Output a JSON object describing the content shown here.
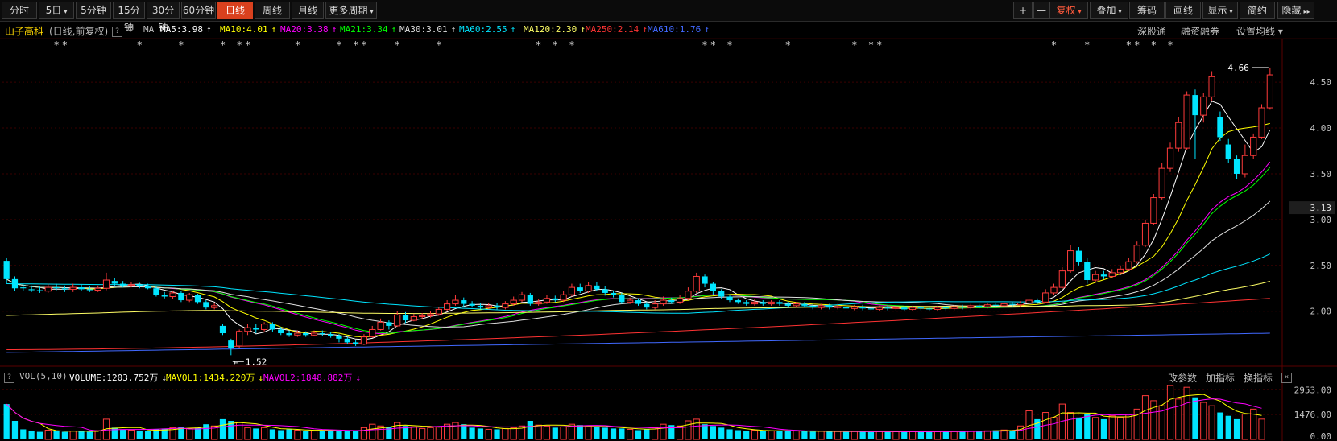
{
  "toolbar": {
    "periods": [
      {
        "label": "分时",
        "active": false
      },
      {
        "label": "5日",
        "active": false,
        "dropdown": true
      },
      {
        "label": "5分钟",
        "active": false
      },
      {
        "label": "15分钟",
        "active": false
      },
      {
        "label": "30分钟",
        "active": false
      },
      {
        "label": "60分钟",
        "active": false
      },
      {
        "label": "日线",
        "active": true
      },
      {
        "label": "周线",
        "active": false
      },
      {
        "label": "月线",
        "active": false
      },
      {
        "label": "更多周期",
        "active": false,
        "dropdown": true
      }
    ],
    "right_buttons": [
      {
        "label": "+",
        "name": "zoom-in-button"
      },
      {
        "label": "—",
        "name": "zoom-out-button"
      },
      {
        "label": "复权",
        "name": "fuquan-button",
        "dropdown": true
      },
      {
        "label": "叠加",
        "name": "overlay-button",
        "dropdown": true
      },
      {
        "label": "筹码",
        "name": "chips-button"
      },
      {
        "label": "画线",
        "name": "draw-line-button"
      },
      {
        "label": "显示",
        "name": "display-button",
        "dropdown": true
      },
      {
        "label": "简约",
        "name": "simple-button"
      },
      {
        "label": "隐藏",
        "name": "hide-button"
      }
    ]
  },
  "info": {
    "stock_name": "山子高科",
    "sub": "(日线,前复权)",
    "ma_label": "MA",
    "ma_items": [
      {
        "text": "MA5:3.98",
        "arrow": "↑",
        "color": "#ffffff"
      },
      {
        "text": "MA10:4.01",
        "arrow": "↑",
        "color": "#ffff00"
      },
      {
        "text": "MA20:3.38",
        "arrow": "↑",
        "color": "#ff00ff"
      },
      {
        "text": "MA21:3.34",
        "arrow": "↑",
        "color": "#00ff00"
      },
      {
        "text": "MA30:3.01",
        "arrow": "↑",
        "color": "#e0e0e0"
      },
      {
        "text": "MA60:2.55",
        "arrow": "↑",
        "color": "#00e5ff"
      },
      {
        "text": "MA120:2.30",
        "arrow": "↑",
        "color": "#ffff66"
      },
      {
        "text": "MA250:2.14",
        "arrow": "↑",
        "color": "#ff3333"
      },
      {
        "text": "MA610:1.76",
        "arrow": "↑",
        "color": "#4169ff"
      }
    ],
    "right_links": [
      "深股通",
      "融资融券",
      "设置均线"
    ]
  },
  "vol_info": {
    "label": "VOL(5,10)",
    "items": [
      {
        "text": "VOLUME:1203.752万",
        "arrow": "↓",
        "color": "#ffffff"
      },
      {
        "text": "MAVOL1:1434.220万",
        "arrow": "↓",
        "color": "#ffff00"
      },
      {
        "text": "MAVOL2:1848.882万",
        "arrow": "↓",
        "color": "#ff00ff"
      }
    ],
    "right_links": [
      "改参数",
      "加指标",
      "换指标"
    ]
  },
  "colors": {
    "up": "#ff3b3b",
    "down": "#00e5ff",
    "bg": "#000000",
    "grid": "#3a0000",
    "axis": "#c8c8c8"
  },
  "chart_data": {
    "type": "candlestick",
    "price_axis_ticks": [
      "4.50",
      "4.00",
      "3.50",
      "3.00",
      "2.50",
      "2.00"
    ],
    "current_price_label": "3.13",
    "ylim": [
      1.4,
      4.8
    ],
    "high_annotation": "4.66",
    "low_annotation": "1.52",
    "candles": [
      [
        2.55,
        2.35,
        2.58,
        2.3
      ],
      [
        2.35,
        2.25,
        2.38,
        2.22
      ],
      [
        2.26,
        2.25,
        2.3,
        2.22
      ],
      [
        2.24,
        2.23,
        2.28,
        2.21
      ],
      [
        2.23,
        2.22,
        2.27,
        2.2
      ],
      [
        2.22,
        2.26,
        2.3,
        2.2
      ],
      [
        2.26,
        2.25,
        2.3,
        2.23
      ],
      [
        2.25,
        2.24,
        2.28,
        2.21
      ],
      [
        2.24,
        2.26,
        2.3,
        2.21
      ],
      [
        2.26,
        2.24,
        2.29,
        2.22
      ],
      [
        2.24,
        2.23,
        2.27,
        2.21
      ],
      [
        2.23,
        2.25,
        2.28,
        2.21
      ],
      [
        2.25,
        2.34,
        2.42,
        2.23
      ],
      [
        2.33,
        2.3,
        2.36,
        2.27
      ],
      [
        2.3,
        2.28,
        2.33,
        2.26
      ],
      [
        2.28,
        2.29,
        2.32,
        2.26
      ],
      [
        2.29,
        2.27,
        2.31,
        2.25
      ],
      [
        2.27,
        2.25,
        2.3,
        2.24
      ],
      [
        2.25,
        2.18,
        2.27,
        2.16
      ],
      [
        2.18,
        2.16,
        2.21,
        2.14
      ],
      [
        2.16,
        2.2,
        2.22,
        2.13
      ],
      [
        2.2,
        2.12,
        2.22,
        2.1
      ],
      [
        2.12,
        2.18,
        2.2,
        2.1
      ],
      [
        2.18,
        2.1,
        2.19,
        2.08
      ],
      [
        2.1,
        2.04,
        2.12,
        2.02
      ],
      [
        2.04,
        2.06,
        2.09,
        2.02
      ],
      [
        1.84,
        1.76,
        1.86,
        1.74
      ],
      [
        1.68,
        1.6,
        1.7,
        1.52
      ],
      [
        1.62,
        1.78,
        1.8,
        1.6
      ],
      [
        1.78,
        1.82,
        1.86,
        1.74
      ],
      [
        1.82,
        1.8,
        1.86,
        1.76
      ],
      [
        1.8,
        1.86,
        1.88,
        1.78
      ],
      [
        1.86,
        1.8,
        1.88,
        1.77
      ],
      [
        1.8,
        1.76,
        1.83,
        1.74
      ],
      [
        1.76,
        1.74,
        1.79,
        1.72
      ],
      [
        1.74,
        1.76,
        1.79,
        1.72
      ],
      [
        1.76,
        1.74,
        1.78,
        1.72
      ],
      [
        1.74,
        1.76,
        1.79,
        1.73
      ],
      [
        1.76,
        1.75,
        1.79,
        1.73
      ],
      [
        1.75,
        1.73,
        1.77,
        1.71
      ],
      [
        1.73,
        1.7,
        1.75,
        1.66
      ],
      [
        1.7,
        1.66,
        1.72,
        1.64
      ],
      [
        1.66,
        1.64,
        1.69,
        1.62
      ],
      [
        1.64,
        1.72,
        1.75,
        1.63
      ],
      [
        1.72,
        1.8,
        1.84,
        1.71
      ],
      [
        1.8,
        1.88,
        1.92,
        1.79
      ],
      [
        1.88,
        1.84,
        1.9,
        1.8
      ],
      [
        1.84,
        1.96,
        2.0,
        1.83
      ],
      [
        1.96,
        1.9,
        1.99,
        1.87
      ],
      [
        1.9,
        1.94,
        1.97,
        1.89
      ],
      [
        1.94,
        1.95,
        1.98,
        1.92
      ],
      [
        1.95,
        1.97,
        2.0,
        1.93
      ],
      [
        1.97,
        2.02,
        2.05,
        1.95
      ],
      [
        2.02,
        2.08,
        2.12,
        2.0
      ],
      [
        2.08,
        2.12,
        2.18,
        2.06
      ],
      [
        2.12,
        2.08,
        2.15,
        2.05
      ],
      [
        2.08,
        2.06,
        2.11,
        2.04
      ],
      [
        2.06,
        2.04,
        2.09,
        2.02
      ],
      [
        2.04,
        2.06,
        2.09,
        2.02
      ],
      [
        2.06,
        2.04,
        2.09,
        2.02
      ],
      [
        2.04,
        2.08,
        2.11,
        2.02
      ],
      [
        2.08,
        2.12,
        2.16,
        2.06
      ],
      [
        2.12,
        2.18,
        2.21,
        2.1
      ],
      [
        2.18,
        2.08,
        2.2,
        2.06
      ],
      [
        2.08,
        2.1,
        2.13,
        2.06
      ],
      [
        2.1,
        2.14,
        2.18,
        2.08
      ],
      [
        2.14,
        2.12,
        2.17,
        2.1
      ],
      [
        2.12,
        2.18,
        2.22,
        2.1
      ],
      [
        2.18,
        2.26,
        2.3,
        2.16
      ],
      [
        2.26,
        2.22,
        2.3,
        2.2
      ],
      [
        2.22,
        2.28,
        2.32,
        2.2
      ],
      [
        2.28,
        2.24,
        2.32,
        2.22
      ],
      [
        2.24,
        2.2,
        2.27,
        2.17
      ],
      [
        2.2,
        2.18,
        2.22,
        2.15
      ],
      [
        2.18,
        2.1,
        2.2,
        2.08
      ],
      [
        2.1,
        2.12,
        2.15,
        2.08
      ],
      [
        2.12,
        2.08,
        2.14,
        2.06
      ],
      [
        2.08,
        2.04,
        2.1,
        2.02
      ],
      [
        2.04,
        2.08,
        2.12,
        2.02
      ],
      [
        2.08,
        2.12,
        2.16,
        2.06
      ],
      [
        2.12,
        2.1,
        2.15,
        2.08
      ],
      [
        2.1,
        2.14,
        2.18,
        2.08
      ],
      [
        2.14,
        2.22,
        2.26,
        2.12
      ],
      [
        2.22,
        2.38,
        2.42,
        2.2
      ],
      [
        2.38,
        2.3,
        2.4,
        2.26
      ],
      [
        2.3,
        2.22,
        2.32,
        2.18
      ],
      [
        2.22,
        2.16,
        2.24,
        2.13
      ],
      [
        2.16,
        2.12,
        2.18,
        2.1
      ],
      [
        2.12,
        2.1,
        2.14,
        2.08
      ],
      [
        2.1,
        2.08,
        2.12,
        2.06
      ],
      [
        2.08,
        2.1,
        2.13,
        2.06
      ],
      [
        2.1,
        2.08,
        2.12,
        2.06
      ],
      [
        2.08,
        2.1,
        2.12,
        2.06
      ],
      [
        2.1,
        2.08,
        2.12,
        2.06
      ],
      [
        2.08,
        2.06,
        2.1,
        2.04
      ],
      [
        2.06,
        2.08,
        2.1,
        2.04
      ],
      [
        2.08,
        2.06,
        2.1,
        2.04
      ],
      [
        2.06,
        2.04,
        2.08,
        2.02
      ],
      [
        2.04,
        2.06,
        2.08,
        2.02
      ],
      [
        2.06,
        2.04,
        2.08,
        2.02
      ],
      [
        2.04,
        2.05,
        2.08,
        2.02
      ],
      [
        2.05,
        2.03,
        2.07,
        2.01
      ],
      [
        2.03,
        2.05,
        2.07,
        2.01
      ],
      [
        2.05,
        2.03,
        2.07,
        2.01
      ],
      [
        2.03,
        2.02,
        2.05,
        2.0
      ],
      [
        2.02,
        2.04,
        2.06,
        2.0
      ],
      [
        2.04,
        2.03,
        2.06,
        2.01
      ],
      [
        2.03,
        2.04,
        2.06,
        2.01
      ],
      [
        2.04,
        2.02,
        2.06,
        2.0
      ],
      [
        2.02,
        2.04,
        2.06,
        2.0
      ],
      [
        2.04,
        2.03,
        2.06,
        2.01
      ],
      [
        2.03,
        2.02,
        2.05,
        2.0
      ],
      [
        2.02,
        2.04,
        2.06,
        2.0
      ],
      [
        2.04,
        2.03,
        2.06,
        2.01
      ],
      [
        2.03,
        2.05,
        2.07,
        2.01
      ],
      [
        2.05,
        2.04,
        2.07,
        2.02
      ],
      [
        2.04,
        2.06,
        2.08,
        2.02
      ],
      [
        2.06,
        2.05,
        2.08,
        2.03
      ],
      [
        2.05,
        2.07,
        2.09,
        2.03
      ],
      [
        2.07,
        2.06,
        2.09,
        2.04
      ],
      [
        2.06,
        2.08,
        2.1,
        2.04
      ],
      [
        2.08,
        2.07,
        2.1,
        2.05
      ],
      [
        2.07,
        2.09,
        2.11,
        2.05
      ],
      [
        2.09,
        2.12,
        2.14,
        2.07
      ],
      [
        2.12,
        2.1,
        2.14,
        2.08
      ],
      [
        2.1,
        2.2,
        2.24,
        2.09
      ],
      [
        2.2,
        2.26,
        2.3,
        2.18
      ],
      [
        2.26,
        2.44,
        2.48,
        2.24
      ],
      [
        2.44,
        2.66,
        2.72,
        2.42
      ],
      [
        2.66,
        2.54,
        2.7,
        2.5
      ],
      [
        2.54,
        2.34,
        2.58,
        2.3
      ],
      [
        2.34,
        2.4,
        2.44,
        2.32
      ],
      [
        2.4,
        2.38,
        2.44,
        2.35
      ],
      [
        2.38,
        2.42,
        2.46,
        2.36
      ],
      [
        2.42,
        2.46,
        2.5,
        2.4
      ],
      [
        2.46,
        2.54,
        2.58,
        2.44
      ],
      [
        2.54,
        2.72,
        2.76,
        2.52
      ],
      [
        2.72,
        2.96,
        3.0,
        2.7
      ],
      [
        2.96,
        3.24,
        3.28,
        2.94
      ],
      [
        3.24,
        3.56,
        3.62,
        3.22
      ],
      [
        3.56,
        3.78,
        3.84,
        3.52
      ],
      [
        3.78,
        4.06,
        4.12,
        3.74
      ],
      [
        3.78,
        4.36,
        4.4,
        3.76
      ],
      [
        4.36,
        4.14,
        4.42,
        3.66
      ],
      [
        4.14,
        4.34,
        4.38,
        4.06
      ],
      [
        4.34,
        4.56,
        4.62,
        4.3
      ],
      [
        4.12,
        3.9,
        4.18,
        3.86
      ],
      [
        3.82,
        3.66,
        3.88,
        3.62
      ],
      [
        3.66,
        3.5,
        3.7,
        3.44
      ],
      [
        3.5,
        3.7,
        3.82,
        3.46
      ],
      [
        3.7,
        3.9,
        3.94,
        3.66
      ],
      [
        3.9,
        4.22,
        4.26,
        3.88
      ],
      [
        4.22,
        4.58,
        4.66,
        4.2
      ]
    ],
    "volumes": [
      2100,
      1100,
      600,
      500,
      450,
      550,
      500,
      450,
      500,
      480,
      450,
      520,
      1200,
      700,
      600,
      550,
      500,
      500,
      600,
      650,
      700,
      750,
      650,
      700,
      900,
      800,
      1200,
      1100,
      1000,
      700,
      650,
      700,
      600,
      550,
      600,
      550,
      520,
      500,
      550,
      500,
      500,
      520,
      480,
      700,
      900,
      800,
      750,
      1000,
      800,
      750,
      650,
      700,
      750,
      900,
      1000,
      900,
      700,
      650,
      600,
      600,
      650,
      700,
      800,
      1100,
      850,
      800,
      700,
      750,
      900,
      850,
      800,
      750,
      700,
      650,
      650,
      600,
      550,
      600,
      700,
      900,
      850,
      800,
      1100,
      1200,
      900,
      800,
      700,
      600,
      550,
      500,
      550,
      500,
      500,
      520,
      480,
      500,
      480,
      470,
      490,
      460,
      470,
      450,
      470,
      460,
      440,
      470,
      450,
      460,
      450,
      470,
      460,
      450,
      470,
      480,
      470,
      500,
      490,
      520,
      510,
      540,
      560,
      520,
      800,
      1700,
      1200,
      1600,
      1300,
      2100,
      1600,
      1300,
      1500,
      1300,
      1200,
      1400,
      1300,
      1500,
      1800,
      2600,
      2300,
      2000,
      3200,
      2400,
      3100,
      2500,
      2200,
      2000,
      1600,
      1400,
      1200,
      1500,
      1800,
      1204
    ],
    "vol_axis_ticks": [
      "2953.00",
      "1476.00",
      "0.00"
    ],
    "vol_ylim": [
      0,
      3300
    ]
  }
}
